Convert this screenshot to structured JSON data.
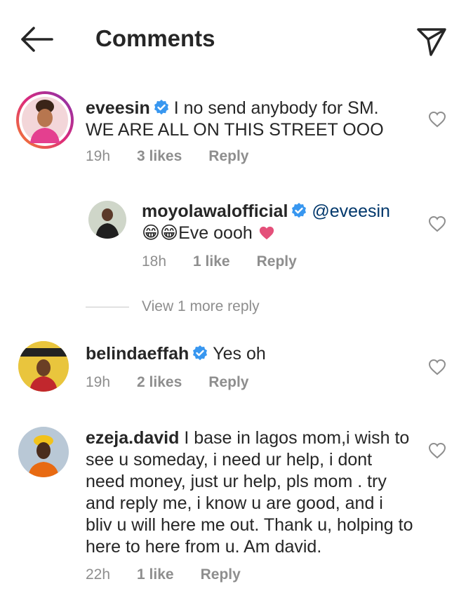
{
  "header": {
    "title": "Comments",
    "back_icon": "arrow-left-icon",
    "share_icon": "paper-plane-icon"
  },
  "comments": [
    {
      "username": "eveesin",
      "text": "I no send anybody for SM. WE ARE ALL ON THIS STREET OOO",
      "time": "19h",
      "likes": "3 likes",
      "reply": "Reply"
    },
    {
      "username": "moyolawalofficial",
      "mention": "@eveesin",
      "text": "😁😁Eve oooh",
      "time": "18h",
      "likes": "1 like",
      "reply": "Reply"
    },
    {
      "username": "belindaeffah",
      "text": "Yes oh",
      "time": "19h",
      "likes": "2 likes",
      "reply": "Reply"
    },
    {
      "username": "ezeja.david",
      "text": "I base in lagos mom,i wish to see u  someday, i need ur help, i dont need money, just ur help, pls mom . try and reply me, i know u are good, and i bliv u will here me out. Thank u, holping to here to here from u. Am david.",
      "time": "22h",
      "likes": "1 like",
      "reply": "Reply"
    }
  ],
  "view_more_replies": "View 1 more reply",
  "colors": {
    "verified_blue": "#3897f0",
    "heart_pink": "#e4507a",
    "secondary_text": "#8e8e8e",
    "story_ring_start": "#f58529",
    "story_ring_end": "#dd2a7b"
  }
}
